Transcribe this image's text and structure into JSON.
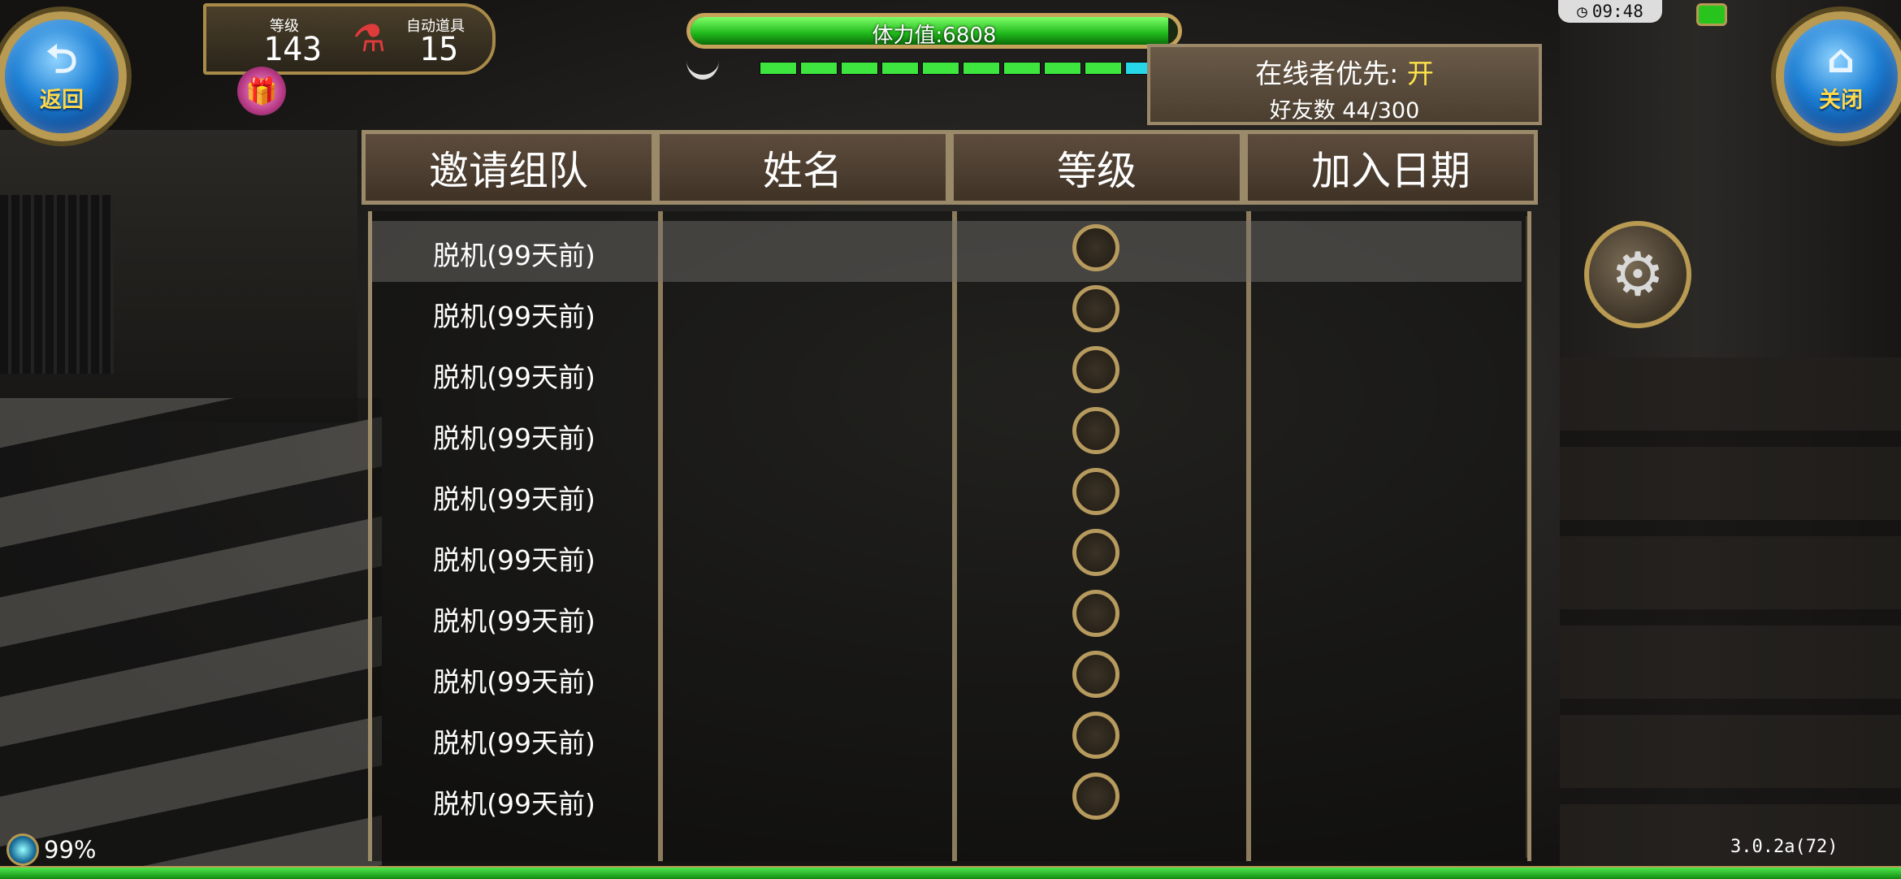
{
  "top_left": {
    "back_label": "返回",
    "level_caption": "等级",
    "level_value": "143",
    "auto_item_caption": "自动道具",
    "auto_item_value": "15"
  },
  "stamina": {
    "text": "体力值:6808",
    "fill_fraction": 0.98,
    "pips_green": 9,
    "pips_cyan": 3
  },
  "status_bar": {
    "clock": "09:48"
  },
  "close_label": "关闭",
  "online_panel": {
    "priority_label": "在线者优先:",
    "priority_value": "开",
    "friends_label": "好友数 44/300"
  },
  "table": {
    "headers": [
      "邀请组队",
      "姓名",
      "等级",
      "加入日期"
    ],
    "rows": [
      {
        "status": "脱机(99天前)"
      },
      {
        "status": "脱机(99天前)"
      },
      {
        "status": "脱机(99天前)"
      },
      {
        "status": "脱机(99天前)"
      },
      {
        "status": "脱机(99天前)"
      },
      {
        "status": "脱机(99天前)"
      },
      {
        "status": "脱机(99天前)"
      },
      {
        "status": "脱机(99天前)"
      },
      {
        "status": "脱机(99天前)"
      },
      {
        "status": "脱机(99天前)"
      }
    ],
    "selected_row": 0
  },
  "bottom": {
    "percent": "99%",
    "version": "3.0.2a(72)"
  },
  "icons": [
    "back-arrow-icon",
    "home-icon",
    "gift-icon",
    "potion-icon",
    "gear-icon",
    "clock-icon",
    "battery-icon"
  ]
}
